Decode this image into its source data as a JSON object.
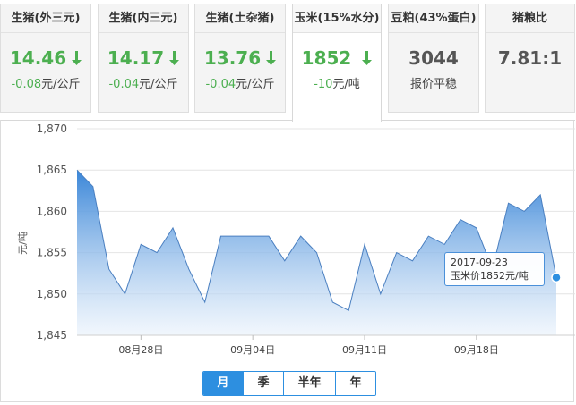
{
  "cards": [
    {
      "title": "生猪(外三元)",
      "price": "14.46",
      "trend": "down",
      "change_value": "-0.08",
      "change_unit": "元/公斤"
    },
    {
      "title": "生猪(内三元)",
      "price": "14.17",
      "trend": "down",
      "change_value": "-0.04",
      "change_unit": "元/公斤"
    },
    {
      "title": "生猪(土杂猪)",
      "price": "13.76",
      "trend": "down",
      "change_value": "-0.04",
      "change_unit": "元/公斤"
    },
    {
      "title": "玉米(15%水分)",
      "price": "1852",
      "trend": "down",
      "change_value": "-10",
      "change_unit": "元/吨"
    },
    {
      "title": "豆粕(43%蛋白)",
      "price": "3044",
      "trend": "flat",
      "change_text": "报价平稳"
    },
    {
      "title": "猪粮比",
      "price": "7.81:1",
      "trend": "none",
      "change_text": ""
    }
  ],
  "colors": {
    "down": "#4caf50",
    "accent": "#2d8fe0",
    "area_top": "#3a86d8",
    "area_bottom": "#e8f1fb",
    "line": "#4a7fc0"
  },
  "icons": {
    "down_arrow": "arrow-down-icon"
  },
  "tooltip": {
    "date": "2017-09-23",
    "label": "玉米价1852元/吨"
  },
  "range_tabs": [
    "月",
    "季",
    "半年",
    "年"
  ],
  "range_tabs_active": 0,
  "chart_data": {
    "type": "area",
    "ylabel": "元/吨",
    "ylim": [
      1845,
      1870
    ],
    "yticks": [
      1845,
      1850,
      1855,
      1860,
      1865,
      1870
    ],
    "ytick_labels": [
      "1,845",
      "1,850",
      "1,855",
      "1,860",
      "1,865",
      "1,870"
    ],
    "xlim": [
      "2017-08-24",
      "2017-09-23"
    ],
    "xticks": [
      "2017-08-28",
      "2017-09-04",
      "2017-09-11",
      "2017-09-18"
    ],
    "xtick_labels": [
      "08月28日",
      "09月04日",
      "09月11日",
      "09月18日"
    ],
    "grid": true,
    "series": [
      {
        "name": "玉米价",
        "x": [
          "2017-08-24",
          "2017-08-25",
          "2017-08-26",
          "2017-08-27",
          "2017-08-28",
          "2017-08-29",
          "2017-08-30",
          "2017-08-31",
          "2017-09-01",
          "2017-09-02",
          "2017-09-03",
          "2017-09-04",
          "2017-09-05",
          "2017-09-06",
          "2017-09-07",
          "2017-09-08",
          "2017-09-09",
          "2017-09-10",
          "2017-09-11",
          "2017-09-12",
          "2017-09-13",
          "2017-09-14",
          "2017-09-15",
          "2017-09-16",
          "2017-09-17",
          "2017-09-18",
          "2017-09-19",
          "2017-09-20",
          "2017-09-21",
          "2017-09-22",
          "2017-09-23"
        ],
        "values": [
          1865,
          1863,
          1853,
          1850,
          1856,
          1855,
          1858,
          1853,
          1849,
          1857,
          1857,
          1857,
          1857,
          1854,
          1857,
          1855,
          1849,
          1848,
          1856,
          1850,
          1855,
          1854,
          1857,
          1856,
          1859,
          1858,
          1853,
          1861,
          1860,
          1862,
          1852
        ]
      }
    ],
    "highlight": {
      "x": "2017-09-23",
      "value": 1852
    }
  }
}
